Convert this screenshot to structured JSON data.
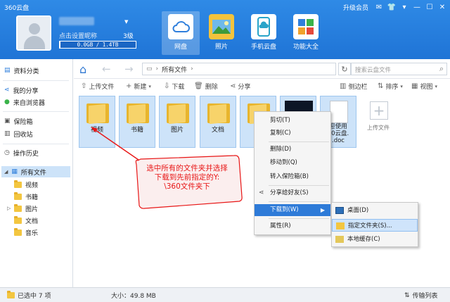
{
  "window": {
    "title": "360云盘",
    "vip_label": "升级会员"
  },
  "user": {
    "nickname": "点击设置昵称",
    "level": "3级",
    "storage_text": "0.0GB / 1.4TB",
    "storage_fraction": 0.01
  },
  "nav": [
    {
      "label": "网盘",
      "icon": "cloud-disk-icon"
    },
    {
      "label": "照片",
      "icon": "photo-icon"
    },
    {
      "label": "手机云盘",
      "icon": "phone-cloud-icon"
    },
    {
      "label": "功能大全",
      "icon": "toolbox-icon"
    }
  ],
  "sidebar": {
    "top": [
      {
        "label": "资料分类",
        "icon": "category-icon"
      },
      {
        "label": "我的分享",
        "icon": "share-icon"
      },
      {
        "label": "来自浏览器",
        "icon": "browser-icon"
      },
      {
        "label": "保险箱",
        "icon": "safe-icon"
      },
      {
        "label": "回收站",
        "icon": "recycle-bin-icon"
      },
      {
        "label": "操作历史",
        "icon": "history-icon"
      },
      {
        "label": "所有文件",
        "icon": "all-files-icon"
      }
    ],
    "folders": [
      "视频",
      "书籍",
      "图片",
      "文档",
      "音乐"
    ]
  },
  "address": {
    "path": "所有文件",
    "search_placeholder": "搜索云盘文件"
  },
  "toolbar": {
    "upload": "上传文件",
    "new": "新建",
    "download": "下载",
    "delete": "删除",
    "share": "分享",
    "sidebar": "侧边栏",
    "sort": "排序",
    "view": "视图"
  },
  "files": [
    {
      "label": "视频"
    },
    {
      "label": "书籍"
    },
    {
      "label": "图片"
    },
    {
      "label": "文档"
    },
    {
      "label": ""
    },
    {
      "label": ""
    },
    {
      "label": "迎使用\n60云盘.\n.doc"
    },
    {
      "label": "上传文件"
    }
  ],
  "context_menu": {
    "cut": "剪切(T)",
    "copy": "复制(C)",
    "delete": "删除(D)",
    "move": "移动到(Q)",
    "to_safe": "转入保险箱(B)",
    "share": "分享给好友(S)",
    "download_to": "下载到(W)",
    "properties": "属性(R)"
  },
  "submenu": {
    "desktop": "桌面(D)",
    "specified": "指定文件夹(S)...",
    "local_cache": "本地缓存(C)"
  },
  "annotation": {
    "lines": [
      "选中所有的文件夹并选择",
      "下载到先前指定的Y:",
      "\\360文件夹下"
    ]
  },
  "status": {
    "selected": "已选中 7 项",
    "size": "大小：49.8 MB",
    "transfer": "传输列表"
  },
  "colors": {
    "header_blue": "#1f74d6",
    "highlight_blue": "#2e7bd8",
    "annotation_red": "#e81616"
  }
}
